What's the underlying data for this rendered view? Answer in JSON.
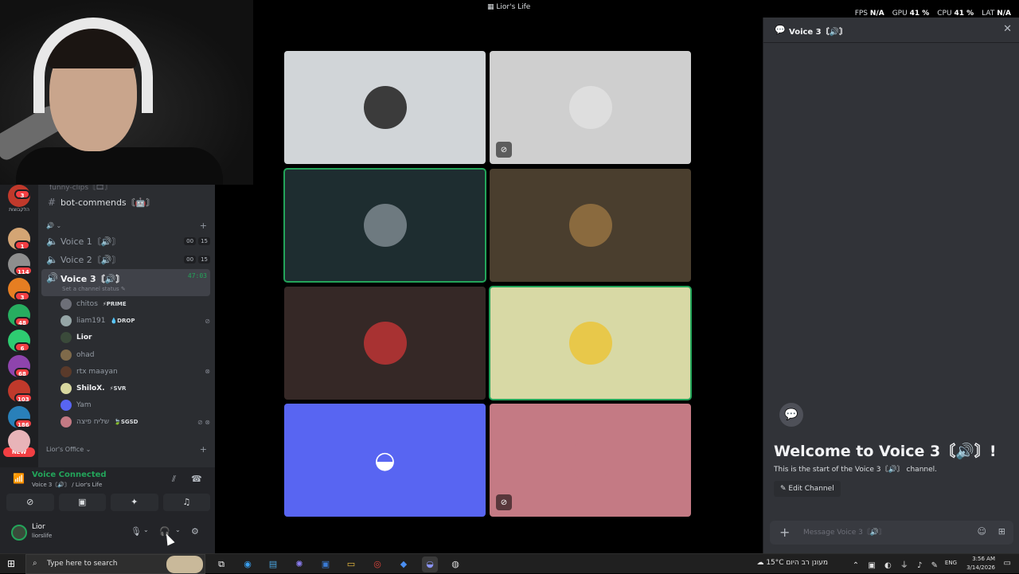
{
  "window": {
    "title": "Lior's Life",
    "title_icon": "discord-server-icon"
  },
  "stats": [
    {
      "label": "FPS",
      "value": "N/A"
    },
    {
      "label": "GPU",
      "value": "41 %"
    },
    {
      "label": "CPU",
      "value": "41 %"
    },
    {
      "label": "LAT",
      "value": "N/A"
    }
  ],
  "rail": {
    "badges": [
      "3",
      "1",
      "114",
      "3",
      "48",
      "6",
      "68",
      "103",
      "186"
    ],
    "hebrew_label": "הלקבוצות",
    "new_badge": "NEW",
    "server_colors": [
      "#c0392b",
      "#d4a574",
      "#8e8e8e",
      "#e67e22",
      "#27ae60",
      "#2ecc71",
      "#8e44ad",
      "#c0392b",
      "#2980b9",
      "#e8b4b8"
    ]
  },
  "sidebar": {
    "cut_row": "funny-clips〘🎞〙",
    "text_channel": {
      "icon": "#",
      "name": "bot-commends〘🤖〙"
    },
    "voice_category_icon": "🔊",
    "voice_channels": [
      {
        "name": "Voice 1〘🔊〙",
        "pill_a": "00",
        "pill_b": "15"
      },
      {
        "name": "Voice 2〘🔊〙",
        "pill_a": "00",
        "pill_b": "15"
      },
      {
        "name": "Voice 3〘🔊〙",
        "timer": "47:03"
      }
    ],
    "channel_status": "Set a channel status",
    "members": [
      {
        "name": "chitos",
        "tag": "⚡PRIME",
        "color": "#6d6f78",
        "bright": false,
        "icon": ""
      },
      {
        "name": "liam191",
        "tag": "💧DROP",
        "color": "#95a5a6",
        "bright": false,
        "icon": "⊘"
      },
      {
        "name": "Lior",
        "tag": "",
        "color": "#3a4a3a",
        "bright": true,
        "icon": ""
      },
      {
        "name": "ohad",
        "tag": "",
        "color": "#7f6a4a",
        "bright": false,
        "icon": ""
      },
      {
        "name": "rtx maayan",
        "tag": "",
        "color": "#5a3a2a",
        "bright": false,
        "icon": "⊗"
      },
      {
        "name": "ShiloX.",
        "tag": "⚡SVR",
        "color": "#d8d8a0",
        "bright": true,
        "icon": ""
      },
      {
        "name": "Yam",
        "tag": "",
        "color": "#5865f2",
        "bright": false,
        "icon": ""
      },
      {
        "name": "שליח פיצה",
        "tag": "🍃SGSD",
        "color": "#c47a84",
        "bright": false,
        "icon": "⊘ ⊗"
      }
    ],
    "category_2": "Lior's Office"
  },
  "voice_panel": {
    "status": "Voice Connected",
    "location": "Voice 3〘🔊〙 / Lior's Life",
    "buttons": [
      "camera-off",
      "screen-share",
      "activities",
      "soundboard"
    ],
    "button_glyphs": [
      "⊘",
      "▣",
      "✦",
      "♫"
    ]
  },
  "user": {
    "name": "Lior",
    "username": "liorslife"
  },
  "tiles": [
    {
      "bg": "#d1d5d8",
      "avatar_bg": "#3b3b3b",
      "muted": false,
      "speaking": false,
      "discord": false
    },
    {
      "bg": "#cfcfcf",
      "avatar_bg": "#dedede",
      "muted": true,
      "speaking": false,
      "discord": false
    },
    {
      "bg": "#1e2d30",
      "avatar_bg": "#6e7a80",
      "muted": false,
      "speaking": true,
      "discord": false
    },
    {
      "bg": "#4a3e2e",
      "avatar_bg": "#8a6a3e",
      "muted": false,
      "speaking": false,
      "discord": false
    },
    {
      "bg": "#352826",
      "avatar_bg": "#a83232",
      "muted": false,
      "speaking": false,
      "discord": false
    },
    {
      "bg": "#d8d9a5",
      "avatar_bg": "#e8c84a",
      "muted": false,
      "speaking": true,
      "discord": false
    },
    {
      "bg": "#5865f2",
      "avatar_bg": "#5865f2",
      "muted": false,
      "speaking": false,
      "discord": true
    },
    {
      "bg": "#c47a84",
      "avatar_bg": "#c47a84",
      "muted": true,
      "speaking": false,
      "discord": false
    }
  ],
  "chat": {
    "header": "Voice 3〘🔊〙",
    "welcome_title": "Welcome to Voice 3〘🔊〙!",
    "welcome_sub": "This is the start of the Voice 3〘🔊〙 channel.",
    "edit_button": "Edit Channel",
    "placeholder": "Message Voice 3〘🔊〙"
  },
  "taskbar": {
    "search_placeholder": "Type here to search",
    "weather": "15°C  מעונן רב היום",
    "lang": "ENG",
    "time": "3:56 AM",
    "date": "3/14/2026"
  }
}
